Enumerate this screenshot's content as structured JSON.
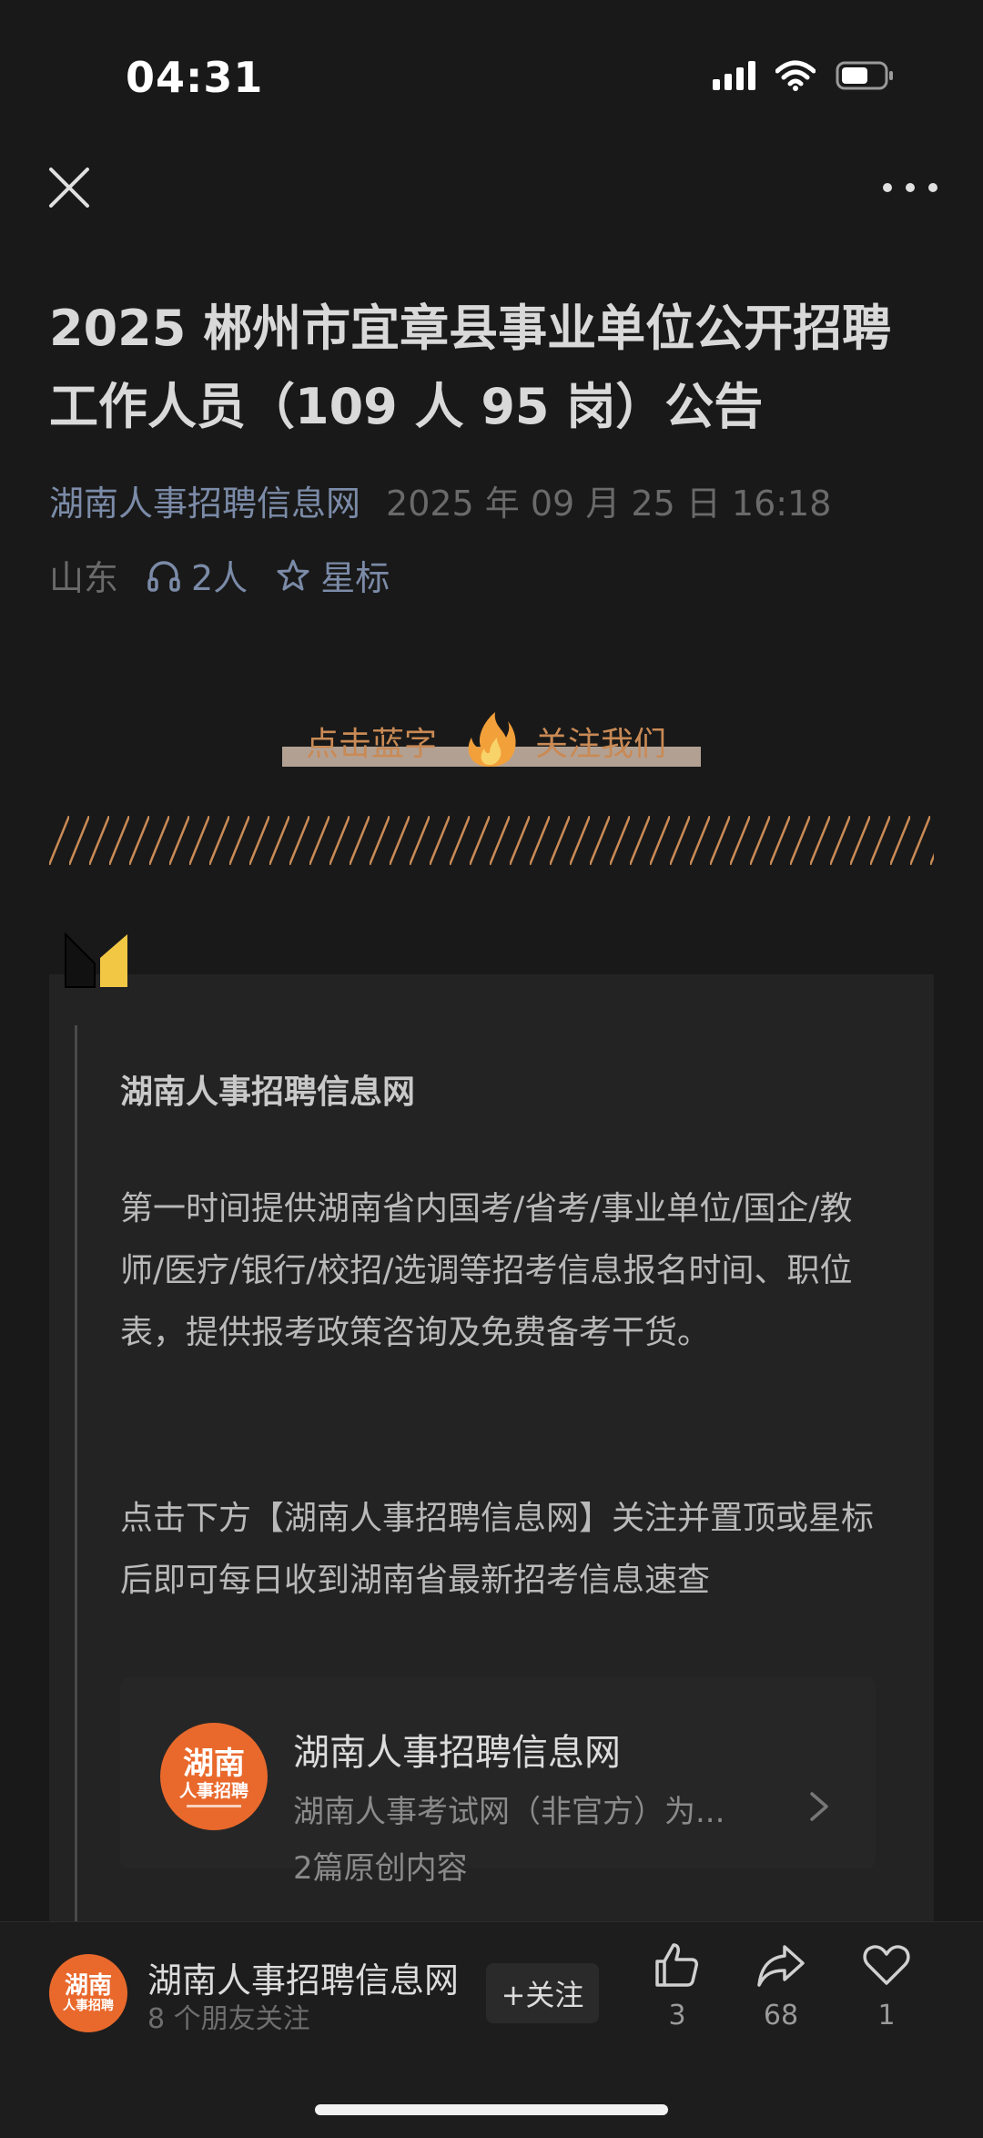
{
  "status_bar": {
    "time": "04:31"
  },
  "article": {
    "title": "2025 郴州市宜章县事业单位公开招聘工作人员（109 人 95 岗）公告",
    "author": "湖南人事招聘信息网",
    "date": "2025 年 09 月 25 日 16:18",
    "region": "山东",
    "listen_count": "2人",
    "star_label": "星标"
  },
  "follow_banner": {
    "left": "点击蓝字",
    "right": "关注我们"
  },
  "card": {
    "heading": "湖南人事招聘信息网",
    "paragraph1": "第一时间提供湖南省内国考/省考/事业单位/国企/教师/医疗/银行/校招/选调等招考信息报名时间、职位表，提供报考政策咨询及免费备考干货。",
    "paragraph2": "点击下方【湖南人事招聘信息网】关注并置顶或星标后即可每日收到湖南省最新招考信息速查"
  },
  "profile": {
    "logo_line1": "湖南",
    "logo_line2": "人事招聘",
    "name": "湖南人事招聘信息网",
    "desc": "湖南人事考试网（非官方）为...",
    "count": "2篇原创内容"
  },
  "bottom_bar": {
    "logo_line1": "湖南",
    "logo_line2": "人事招聘",
    "name": "湖南人事招聘信息网",
    "friends": "8 个朋友关注",
    "follow_label": "+关注",
    "like_count": "3",
    "share_count": "68",
    "heart_count": "1"
  },
  "colors": {
    "background": "#191919",
    "accent_orange": "#e9692c",
    "link_blue": "#7b8ba8"
  }
}
